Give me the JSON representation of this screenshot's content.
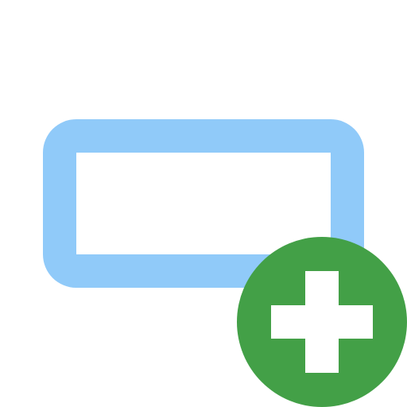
{
  "icon": {
    "name": "add-field-icon",
    "colors": {
      "background": "#ffffff",
      "field_outline": "#90CAF9",
      "add_badge": "#43A047",
      "plus_sign": "#ffffff"
    }
  }
}
